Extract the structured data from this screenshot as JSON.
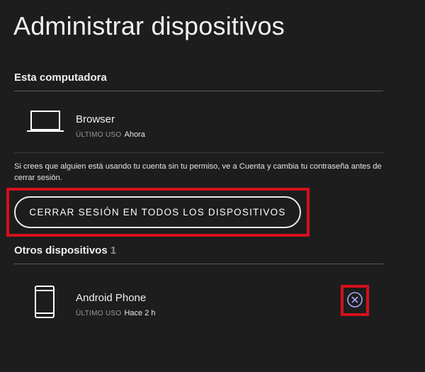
{
  "page": {
    "title": "Administrar dispositivos"
  },
  "this_computer": {
    "heading": "Esta computadora",
    "device": {
      "name": "Browser",
      "last_used_label": "ÚLTIMO USO",
      "last_used_value": "Ahora",
      "icon": "laptop-icon"
    }
  },
  "warning": {
    "text": "Si crees que alguien está usando tu cuenta sin tu permiso, ve a Cuenta y cambia tu contraseña antes de cerrar sesión."
  },
  "signout_all": {
    "label": "CERRAR SESIÓN EN TODOS LOS DISPOSITIVOS"
  },
  "other_devices": {
    "heading": "Otros dispositivos",
    "count": "1",
    "devices": [
      {
        "name": "Android Phone",
        "last_used_label": "ÚLTIMO USO",
        "last_used_value": "Hace 2 h",
        "icon": "phone-icon",
        "remove_icon": "close-circle-icon"
      }
    ]
  },
  "colors": {
    "background": "#1d1d1d",
    "text": "#ffffff",
    "muted": "#9a9a9a",
    "highlight": "#d4101c",
    "remove_icon": "#a8a8ff"
  }
}
